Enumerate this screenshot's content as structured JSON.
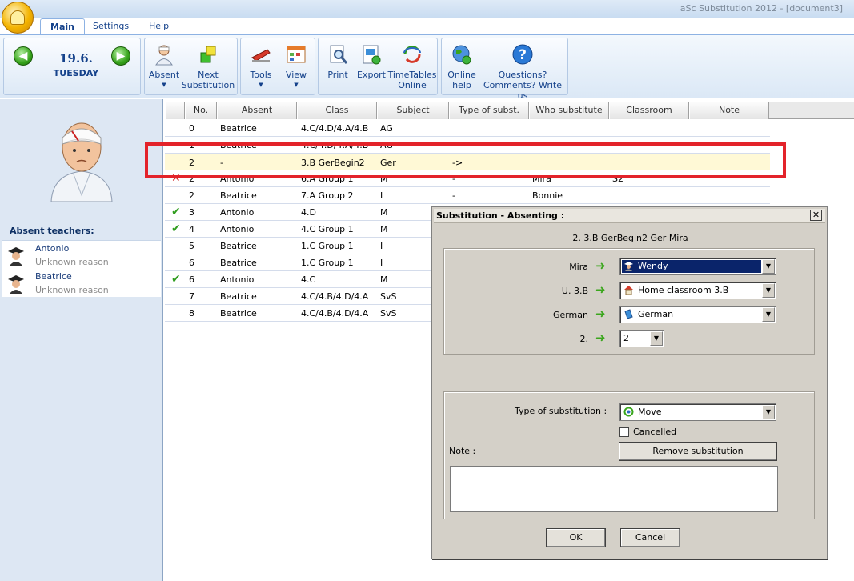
{
  "window": {
    "title": "aSc Substitution 2012  - [document3]"
  },
  "tabs": [
    {
      "label": "Main"
    },
    {
      "label": "Settings"
    },
    {
      "label": "Help"
    }
  ],
  "ribbon": {
    "date": {
      "day": "19.6.",
      "weekday": "TUESDAY"
    },
    "absent": "Absent",
    "next_sub_1": "Next",
    "next_sub_2": "Substitution",
    "tools": "Tools",
    "view": "View",
    "print": "Print",
    "export": "Export",
    "timetables_1": "TimeTables",
    "timetables_2": "Online",
    "online_help_1": "Online",
    "online_help_2": "help",
    "questions_1": "Questions?",
    "questions_2": "Comments? Write us"
  },
  "left": {
    "absent_title": "Absent teachers:",
    "teachers": [
      {
        "name": "Antonio",
        "reason": "Unknown reason"
      },
      {
        "name": "Beatrice",
        "reason": "Unknown reason"
      }
    ]
  },
  "grid": {
    "columns": [
      "No.",
      "Absent",
      "Class",
      "Subject",
      "Type of subst.",
      "Who substitute",
      "Classroom",
      "Note"
    ],
    "rows": [
      {
        "mark": "",
        "no": "0",
        "absent": "Beatrice",
        "class": "4.C/4.D/4.A/4.B",
        "subject": "AG",
        "type": "",
        "who": "",
        "room": ""
      },
      {
        "mark": "",
        "no": "1",
        "absent": "Beatrice",
        "class": "4.C/4.D/4.A/4.B",
        "subject": "AG",
        "type": "",
        "who": "",
        "room": ""
      },
      {
        "mark": "",
        "no": "2",
        "absent": "-",
        "class": "3.B GerBegin2",
        "subject": "Ger",
        "type": "->",
        "who": "",
        "room": ""
      },
      {
        "mark": "✕",
        "no": "2",
        "absent": "Antonio",
        "class": "6.A Group 1",
        "subject": "M",
        "type": "-",
        "who": "Mira",
        "room": "S2"
      },
      {
        "mark": "",
        "no": "2",
        "absent": "Beatrice",
        "class": "7.A Group 2",
        "subject": "I",
        "type": "-",
        "who": "Bonnie",
        "room": ""
      },
      {
        "mark": "✔",
        "no": "3",
        "absent": "Antonio",
        "class": "4.D",
        "subject": "M",
        "type": "",
        "who": "",
        "room": ""
      },
      {
        "mark": "✔",
        "no": "4",
        "absent": "Antonio",
        "class": "4.C Group 1",
        "subject": "M",
        "type": "",
        "who": "",
        "room": ""
      },
      {
        "mark": "",
        "no": "5",
        "absent": "Beatrice",
        "class": "1.C Group 1",
        "subject": "I",
        "type": "",
        "who": "",
        "room": ""
      },
      {
        "mark": "",
        "no": "6",
        "absent": "Beatrice",
        "class": "1.C Group 1",
        "subject": "I",
        "type": "",
        "who": "",
        "room": ""
      },
      {
        "mark": "✔",
        "no": "6",
        "absent": "Antonio",
        "class": "4.C",
        "subject": "M",
        "type": "",
        "who": "",
        "room": ""
      },
      {
        "mark": "",
        "no": "7",
        "absent": "Beatrice",
        "class": "4.C/4.B/4.D/4.A",
        "subject": "SvS",
        "type": "",
        "who": "",
        "room": ""
      },
      {
        "mark": "",
        "no": "8",
        "absent": "Beatrice",
        "class": "4.C/4.B/4.D/4.A",
        "subject": "SvS",
        "type": "",
        "who": "",
        "room": ""
      }
    ]
  },
  "dialog": {
    "title": "Substitution - Absenting :",
    "close": "✕",
    "subheader": "2. 3.B GerBegin2 Ger Mira",
    "teacher_label": "Mira",
    "teacher_value": "Wendy",
    "room_label": "U. 3.B",
    "room_value": "Home classroom 3.B",
    "subject_label": "German",
    "subject_value": "German",
    "period_label": "2.",
    "period_value": "2",
    "type_label": "Type of substitution :",
    "type_value": "Move",
    "cancelled_label": "Cancelled",
    "note_label": "Note :",
    "remove_button": "Remove substitution",
    "ok_button": "OK",
    "cancel_button": "Cancel"
  }
}
